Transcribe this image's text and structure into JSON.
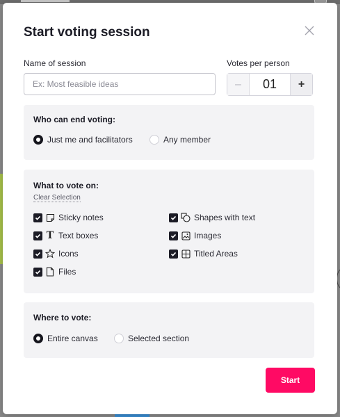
{
  "dialog": {
    "title": "Start voting session",
    "close_icon": "close-icon"
  },
  "session_name": {
    "label": "Name of session",
    "placeholder": "Ex: Most feasible ideas",
    "value": ""
  },
  "votes_per_person": {
    "label": "Votes per person",
    "value": "01",
    "minus": "–",
    "plus": "+"
  },
  "end_voting": {
    "title": "Who can end voting:",
    "options": [
      {
        "label": "Just me and facilitators",
        "selected": true
      },
      {
        "label": "Any member",
        "selected": false
      }
    ]
  },
  "vote_on": {
    "title": "What to vote on:",
    "clear_label": "Clear Selection",
    "items": [
      {
        "label": "Sticky notes",
        "icon": "sticky-note-icon",
        "checked": true
      },
      {
        "label": "Shapes with text",
        "icon": "shapes-icon",
        "checked": true
      },
      {
        "label": "Text boxes",
        "icon": "text-icon",
        "checked": true
      },
      {
        "label": "Images",
        "icon": "image-icon",
        "checked": true
      },
      {
        "label": "Icons",
        "icon": "star-icon",
        "checked": true
      },
      {
        "label": "Titled Areas",
        "icon": "grid-icon",
        "checked": true
      },
      {
        "label": "Files",
        "icon": "file-icon",
        "checked": true
      }
    ]
  },
  "where_to_vote": {
    "title": "Where to vote:",
    "options": [
      {
        "label": "Entire canvas",
        "selected": true
      },
      {
        "label": "Selected section",
        "selected": false
      }
    ]
  },
  "actions": {
    "start_label": "Start"
  },
  "colors": {
    "accent": "#ff0a64",
    "panel_bg": "#f3f3f5",
    "text": "#1c1c26"
  }
}
